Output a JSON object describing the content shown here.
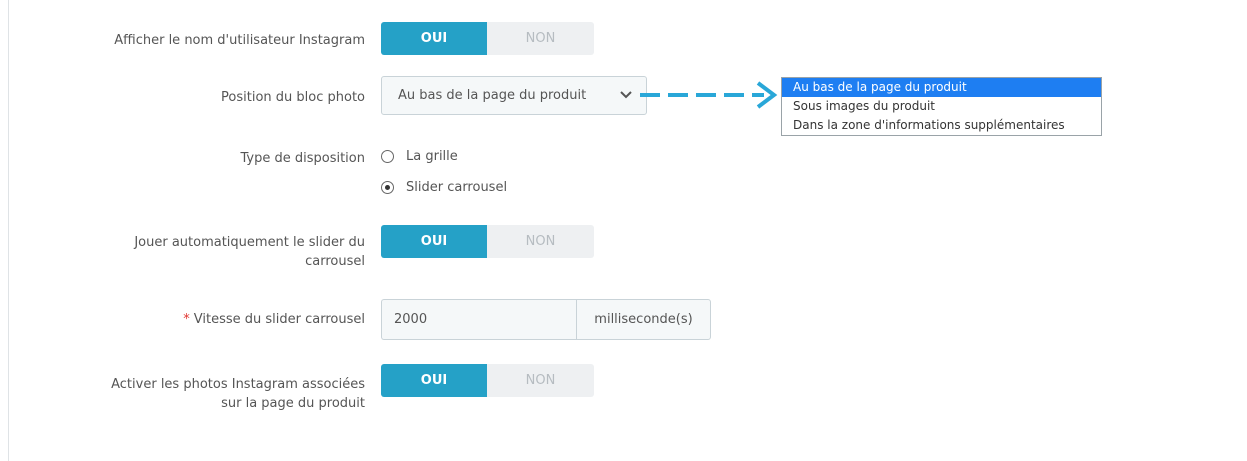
{
  "form": {
    "row_username": {
      "label": "Afficher le nom d'utilisateur Instagram",
      "on": "OUI",
      "off": "NON"
    },
    "row_position": {
      "label": "Position du bloc photo",
      "selected": "Au bas de la page du produit"
    },
    "dropdown": {
      "options": [
        "Au bas de la page du produit",
        "Sous images du produit",
        "Dans la zone d'informations supplémentaires"
      ]
    },
    "row_layout": {
      "label": "Type de disposition",
      "options": [
        "La grille",
        "Slider carrousel"
      ],
      "checked_index": 1
    },
    "row_autoplay": {
      "label_line1": "Jouer automatiquement le slider du",
      "label_line2": "carrousel",
      "on": "OUI",
      "off": "NON"
    },
    "row_speed": {
      "required_mark": "*",
      "label": "Vitesse du slider carrousel",
      "value": "2000",
      "unit": "milliseconde(s)"
    },
    "row_related": {
      "label_line1": "Activer les photos Instagram associées",
      "label_line2": "sur la page du produit",
      "on": "OUI",
      "off": "NON"
    }
  },
  "colors": {
    "accent": "#25a1c7",
    "selected_option": "#1e7ef2",
    "required": "#e0342f"
  }
}
